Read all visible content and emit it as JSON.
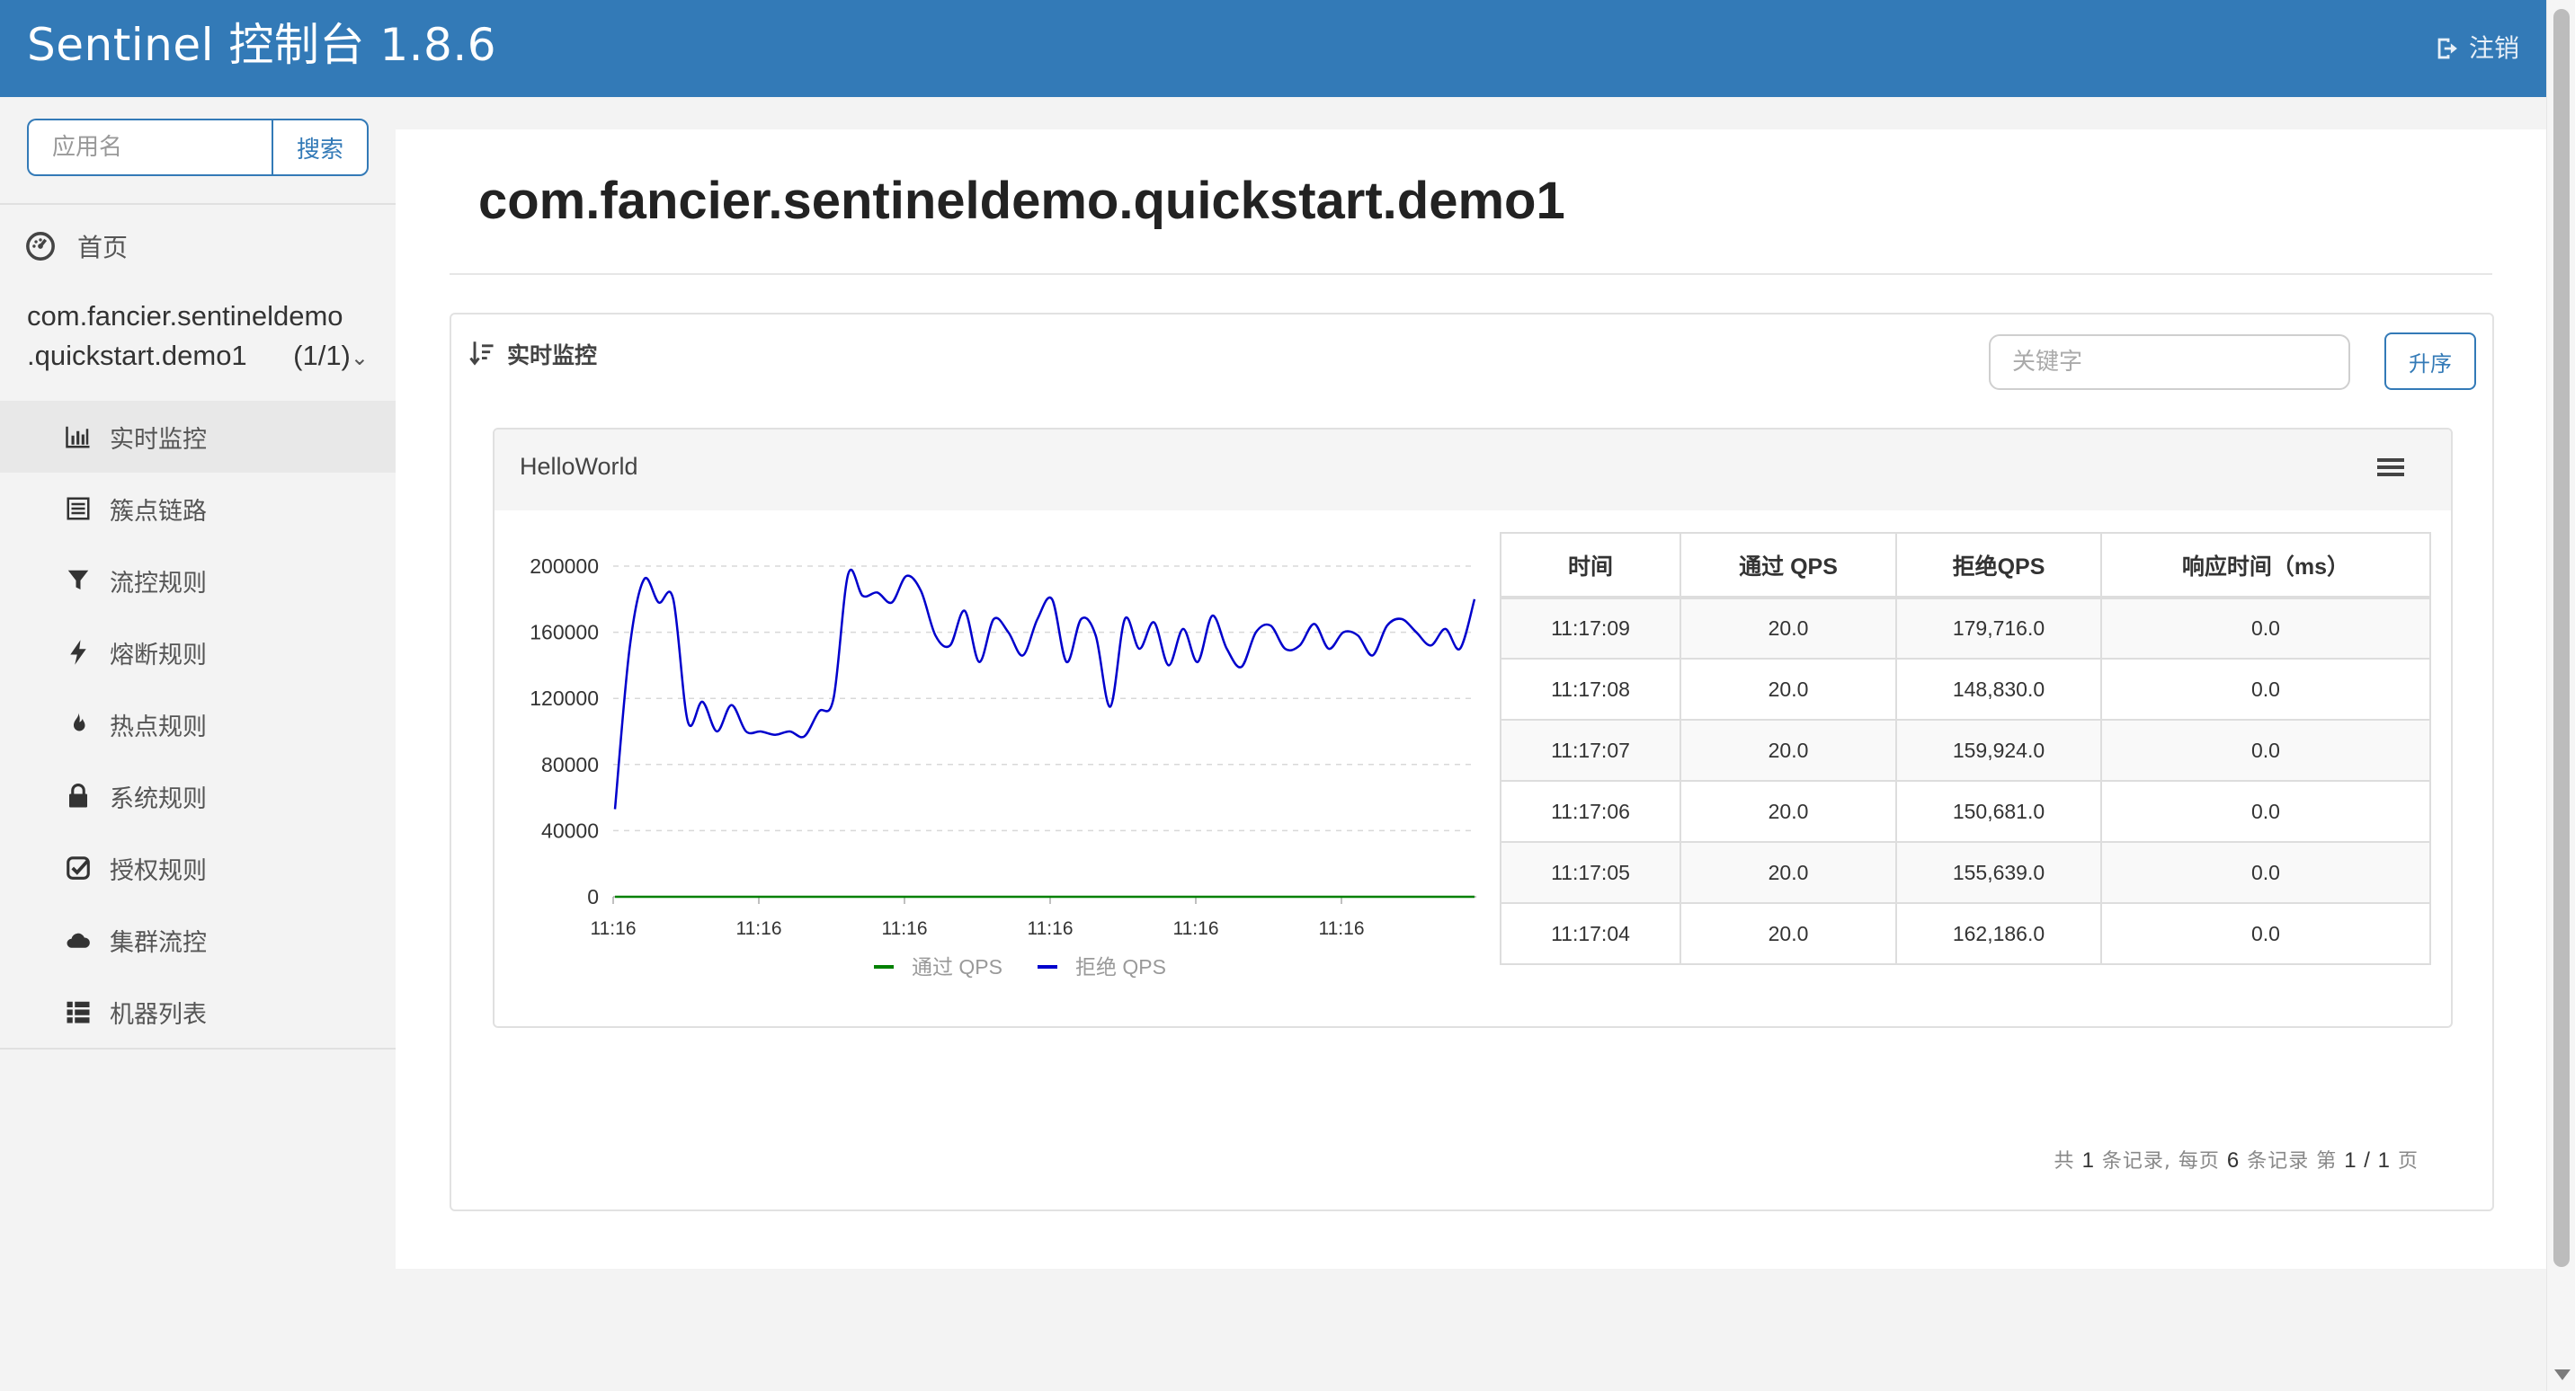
{
  "header": {
    "title": "Sentinel 控制台 1.8.6",
    "logout_label": "注销"
  },
  "sidebar": {
    "search": {
      "placeholder": "应用名",
      "button": "搜索"
    },
    "home_label": "首页",
    "app": {
      "name_line1": "com.fancier.sentineldemo",
      "name_line2": ".quickstart.demo1",
      "count": "(1/1)"
    },
    "items": [
      {
        "label": "实时监控",
        "icon": "bar-chart-icon",
        "active": true
      },
      {
        "label": "簇点链路",
        "icon": "list-icon"
      },
      {
        "label": "流控规则",
        "icon": "filter-icon"
      },
      {
        "label": "熔断规则",
        "icon": "flash-icon"
      },
      {
        "label": "热点规则",
        "icon": "fire-icon"
      },
      {
        "label": "系统规则",
        "icon": "lock-icon"
      },
      {
        "label": "授权规则",
        "icon": "check-icon"
      },
      {
        "label": "集群流控",
        "icon": "cloud-icon"
      },
      {
        "label": "机器列表",
        "icon": "th-list-icon"
      }
    ]
  },
  "main": {
    "page_title": "com.fancier.sentineldemo.quickstart.demo1",
    "panel_title": "实时监控",
    "keyword_placeholder": "关键字",
    "sort_button": "升序",
    "resource": {
      "name": "HelloWorld",
      "table": {
        "headers": [
          "时间",
          "通过 QPS",
          "拒绝QPS",
          "响应时间（ms）"
        ],
        "rows": [
          [
            "11:17:09",
            "20.0",
            "179,716.0",
            "0.0"
          ],
          [
            "11:17:08",
            "20.0",
            "148,830.0",
            "0.0"
          ],
          [
            "11:17:07",
            "20.0",
            "159,924.0",
            "0.0"
          ],
          [
            "11:17:06",
            "20.0",
            "150,681.0",
            "0.0"
          ],
          [
            "11:17:05",
            "20.0",
            "155,639.0",
            "0.0"
          ],
          [
            "11:17:04",
            "20.0",
            "162,186.0",
            "0.0"
          ]
        ]
      }
    },
    "pager": {
      "prefix": "共",
      "total": "1",
      "mid1": "条记录, 每页",
      "per_page": "6",
      "mid2": "条记录 第",
      "page": "1 / 1",
      "suffix": "页"
    }
  },
  "chart_data": {
    "type": "line",
    "x_tick_labels": [
      "11:16",
      "11:16",
      "11:16",
      "11:16",
      "11:16",
      "11:16"
    ],
    "y_ticks": [
      0,
      40000,
      80000,
      120000,
      160000,
      200000
    ],
    "ylim": [
      0,
      200000
    ],
    "legend_position": "bottom",
    "series": [
      {
        "name": "通过 QPS",
        "color": "#008000",
        "values": [
          20,
          20,
          20,
          20,
          20,
          20,
          20,
          20,
          20,
          20,
          20,
          20,
          20,
          20,
          20,
          20,
          20,
          20,
          20,
          20,
          20,
          20,
          20,
          20,
          20,
          20,
          20,
          20,
          20,
          20,
          20,
          20,
          20,
          20,
          20,
          20,
          20,
          20,
          20,
          20,
          20,
          20,
          20,
          20,
          20,
          20,
          20,
          20,
          20,
          20,
          20,
          20,
          20,
          20,
          20,
          20,
          20,
          20,
          20,
          20
        ]
      },
      {
        "name": "拒绝 QPS",
        "color": "#0000cc",
        "values": [
          53000,
          150000,
          192000,
          178000,
          180000,
          106000,
          118000,
          100000,
          116000,
          100000,
          100000,
          98000,
          100000,
          97000,
          112000,
          120000,
          195000,
          182000,
          184000,
          178000,
          194000,
          185000,
          158000,
          152000,
          173000,
          142000,
          168000,
          160000,
          146000,
          168000,
          180000,
          142000,
          168000,
          158000,
          115000,
          168000,
          150000,
          166000,
          140000,
          162000,
          142000,
          170000,
          150000,
          139000,
          160000,
          164000,
          150000,
          152000,
          165000,
          150000,
          160000,
          158000,
          146000,
          164000,
          168000,
          160000,
          152000,
          162000,
          150000,
          180000
        ]
      }
    ]
  }
}
